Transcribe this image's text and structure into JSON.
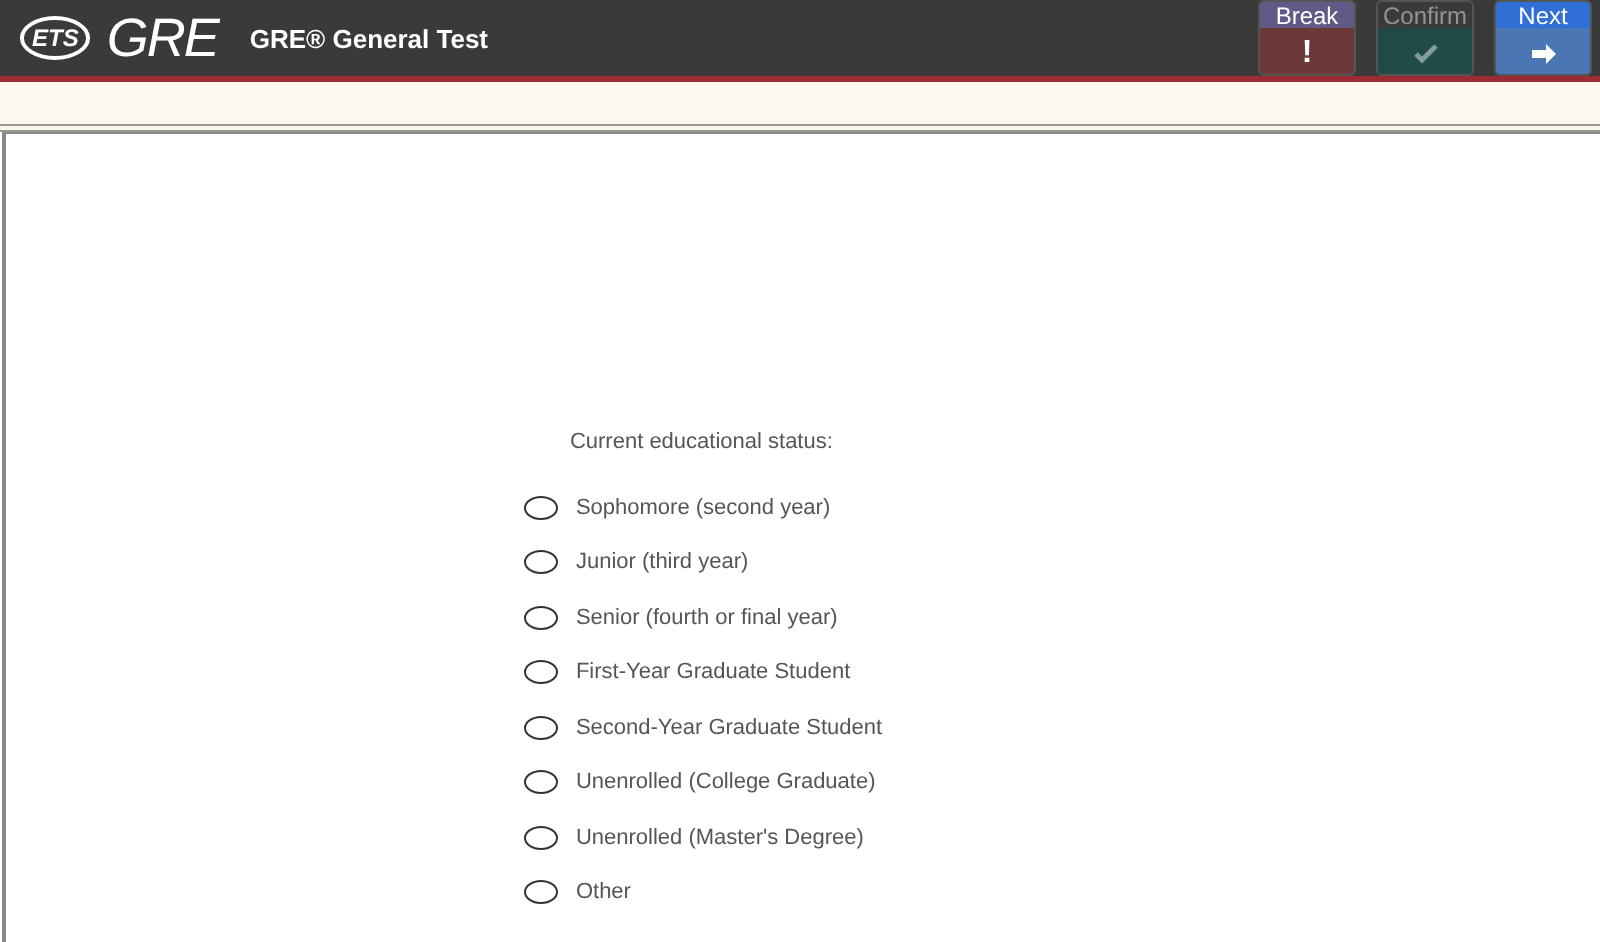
{
  "header": {
    "logo_ets": "ETS",
    "logo_gre": "GRE",
    "title": "GRE® General Test"
  },
  "toolbar": [
    {
      "kind": "break",
      "label": "Break",
      "symbol": "!",
      "disabled": false
    },
    {
      "kind": "confirm",
      "label": "Confirm",
      "disabled": true
    },
    {
      "kind": "next",
      "label": "Next",
      "disabled": false
    }
  ],
  "question": {
    "prompt": "Current educational status:",
    "options": [
      {
        "label": "Sophomore (second year)",
        "selected": false
      },
      {
        "label": "Junior (third year)",
        "selected": false
      },
      {
        "label": "Senior (fourth or final year)",
        "selected": false
      },
      {
        "label": "First-Year Graduate Student",
        "selected": false
      },
      {
        "label": "Second-Year Graduate Student",
        "selected": false
      },
      {
        "label": "Unenrolled (College Graduate)",
        "selected": false
      },
      {
        "label": "Unenrolled (Master's Degree)",
        "selected": false
      },
      {
        "label": "Other",
        "selected": false
      }
    ]
  }
}
